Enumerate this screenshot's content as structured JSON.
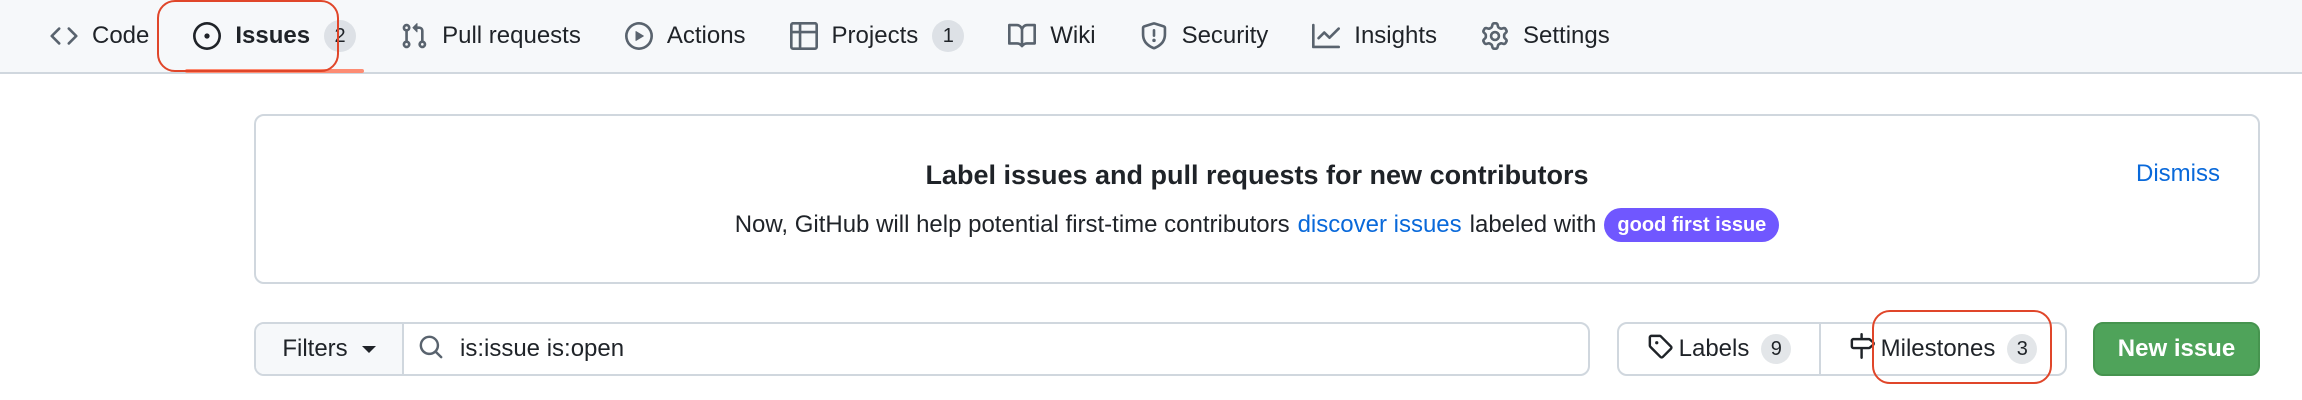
{
  "nav": {
    "items": [
      {
        "label": "Code",
        "icon": "code-icon"
      },
      {
        "label": "Issues",
        "icon": "issue-opened-icon",
        "count": "2",
        "selected": true
      },
      {
        "label": "Pull requests",
        "icon": "git-pull-request-icon"
      },
      {
        "label": "Actions",
        "icon": "play-icon"
      },
      {
        "label": "Projects",
        "icon": "table-icon",
        "count": "1"
      },
      {
        "label": "Wiki",
        "icon": "book-icon"
      },
      {
        "label": "Security",
        "icon": "shield-icon"
      },
      {
        "label": "Insights",
        "icon": "graph-icon"
      },
      {
        "label": "Settings",
        "icon": "gear-icon"
      }
    ]
  },
  "banner": {
    "title": "Label issues and pull requests for new contributors",
    "body_prefix": "Now, GitHub will help potential first-time contributors",
    "link": "discover issues",
    "body_suffix": "labeled with",
    "label": "good first issue",
    "dismiss": "Dismiss"
  },
  "toolbar": {
    "filters": "Filters",
    "search_value": "is:issue is:open",
    "labels": "Labels",
    "labels_count": "9",
    "milestones": "Milestones",
    "milestones_count": "3",
    "new_issue": "New issue"
  },
  "colors": {
    "accent_underline": "#fd8c73",
    "link": "#0969da",
    "label_bg": "#7057ff",
    "primary_button": "#4fa35a",
    "annotation": "#e0462a"
  }
}
